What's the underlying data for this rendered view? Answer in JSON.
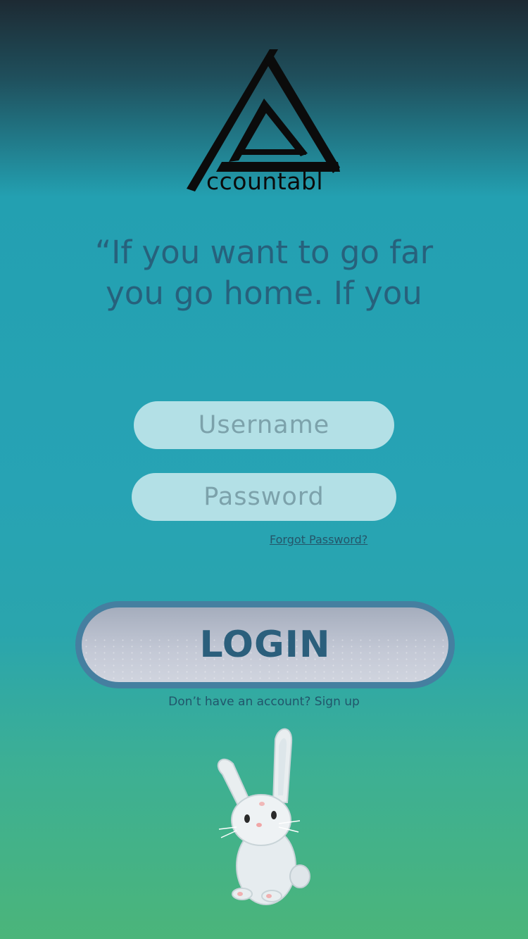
{
  "logo": {
    "text": "ccountabl",
    "icon": "stylized-letter-a-logo"
  },
  "quote": {
    "text": "“If you want to go far you go home. If you"
  },
  "form": {
    "username_placeholder": "Username",
    "password_placeholder": "Password",
    "forgot_label": "Forgot Password?",
    "login_label": "LOGIN",
    "signup_label": "Don’t have an account? Sign up"
  },
  "mascot": {
    "icon": "bunny-illustration"
  },
  "colors": {
    "accent": "#27617c",
    "field_bg": "#b3e0e6",
    "button_ring": "#457fa0",
    "button_fill": "#c4c9d6"
  }
}
